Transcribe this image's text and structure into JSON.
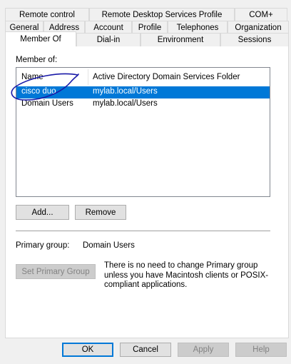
{
  "tabs": {
    "row1": [
      "Remote control",
      "Remote Desktop Services Profile",
      "COM+"
    ],
    "row2": [
      "General",
      "Address",
      "Account",
      "Profile",
      "Telephones",
      "Organization"
    ],
    "row3": [
      "Member Of",
      "Dial-in",
      "Environment",
      "Sessions"
    ]
  },
  "member_of": {
    "label": "Member of:",
    "columns": [
      "Name",
      "Active Directory Domain Services Folder"
    ],
    "rows": [
      {
        "name": "cisco duo",
        "folder": "mylab.local/Users",
        "selected": true
      },
      {
        "name": "Domain Users",
        "folder": "mylab.local/Users",
        "selected": false
      }
    ]
  },
  "buttons": {
    "add": "Add...",
    "remove": "Remove",
    "set_primary": "Set Primary Group"
  },
  "primary_group": {
    "label": "Primary group:",
    "value": "Domain Users",
    "note": "There is no need to change Primary group unless you have Macintosh clients or POSIX-compliant applications."
  },
  "dialog": {
    "ok": "OK",
    "cancel": "Cancel",
    "apply": "Apply",
    "help": "Help"
  },
  "colors": {
    "selection": "#0078d7",
    "annotation": "#1a1aa8"
  }
}
